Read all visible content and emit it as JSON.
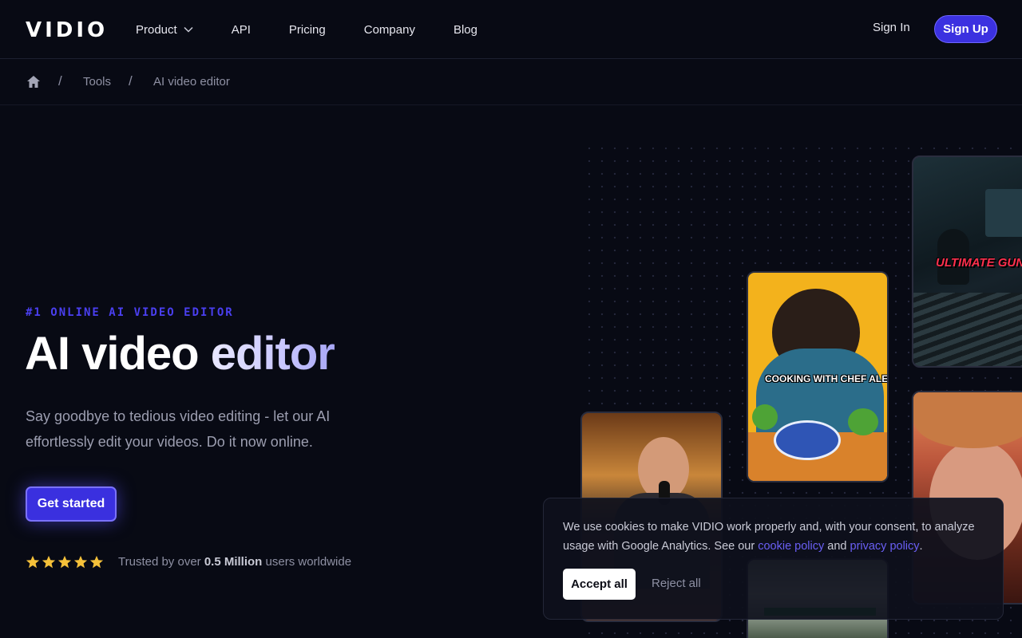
{
  "brand": {
    "logo": "VIDIO",
    "accent": "#3b31e0"
  },
  "nav": {
    "items": [
      {
        "label": "Product",
        "has_dropdown": true
      },
      {
        "label": "API"
      },
      {
        "label": "Pricing"
      },
      {
        "label": "Company"
      },
      {
        "label": "Blog"
      }
    ],
    "sign_in": "Sign In",
    "sign_up": "Sign Up"
  },
  "breadcrumb": {
    "home_icon": "home-icon",
    "separator": "/",
    "items": [
      "Tools",
      "AI video editor"
    ]
  },
  "hero": {
    "eyebrow": "#1 ONLINE AI VIDEO EDITOR",
    "title_part1": "AI video ",
    "title_part2": "editor",
    "subtitle": "Say goodbye to tedious video editing - let our AI effortlessly edit your videos. Do it now online.",
    "cta": "Get started",
    "rating": {
      "stars": 5,
      "max": 5
    },
    "trust_prefix": "Trusted by over ",
    "trust_bold": "0.5 Million",
    "trust_suffix": " users worldwide"
  },
  "thumbnails": [
    {
      "caption": "ULTIMATE GUNFIGI"
    },
    {
      "caption": "COOKING WITH CHEF ALEX"
    },
    {
      "caption": ""
    },
    {
      "caption": ""
    },
    {
      "caption": ""
    }
  ],
  "cookie": {
    "text_start": "We use cookies to make VIDIO work properly and, with your consent, to analyze usage with Google Analytics. See our ",
    "cookie_policy": "cookie policy",
    "and": " and ",
    "privacy_policy": "privacy policy",
    "end": ".",
    "accept": "Accept all",
    "reject": "Reject all"
  }
}
